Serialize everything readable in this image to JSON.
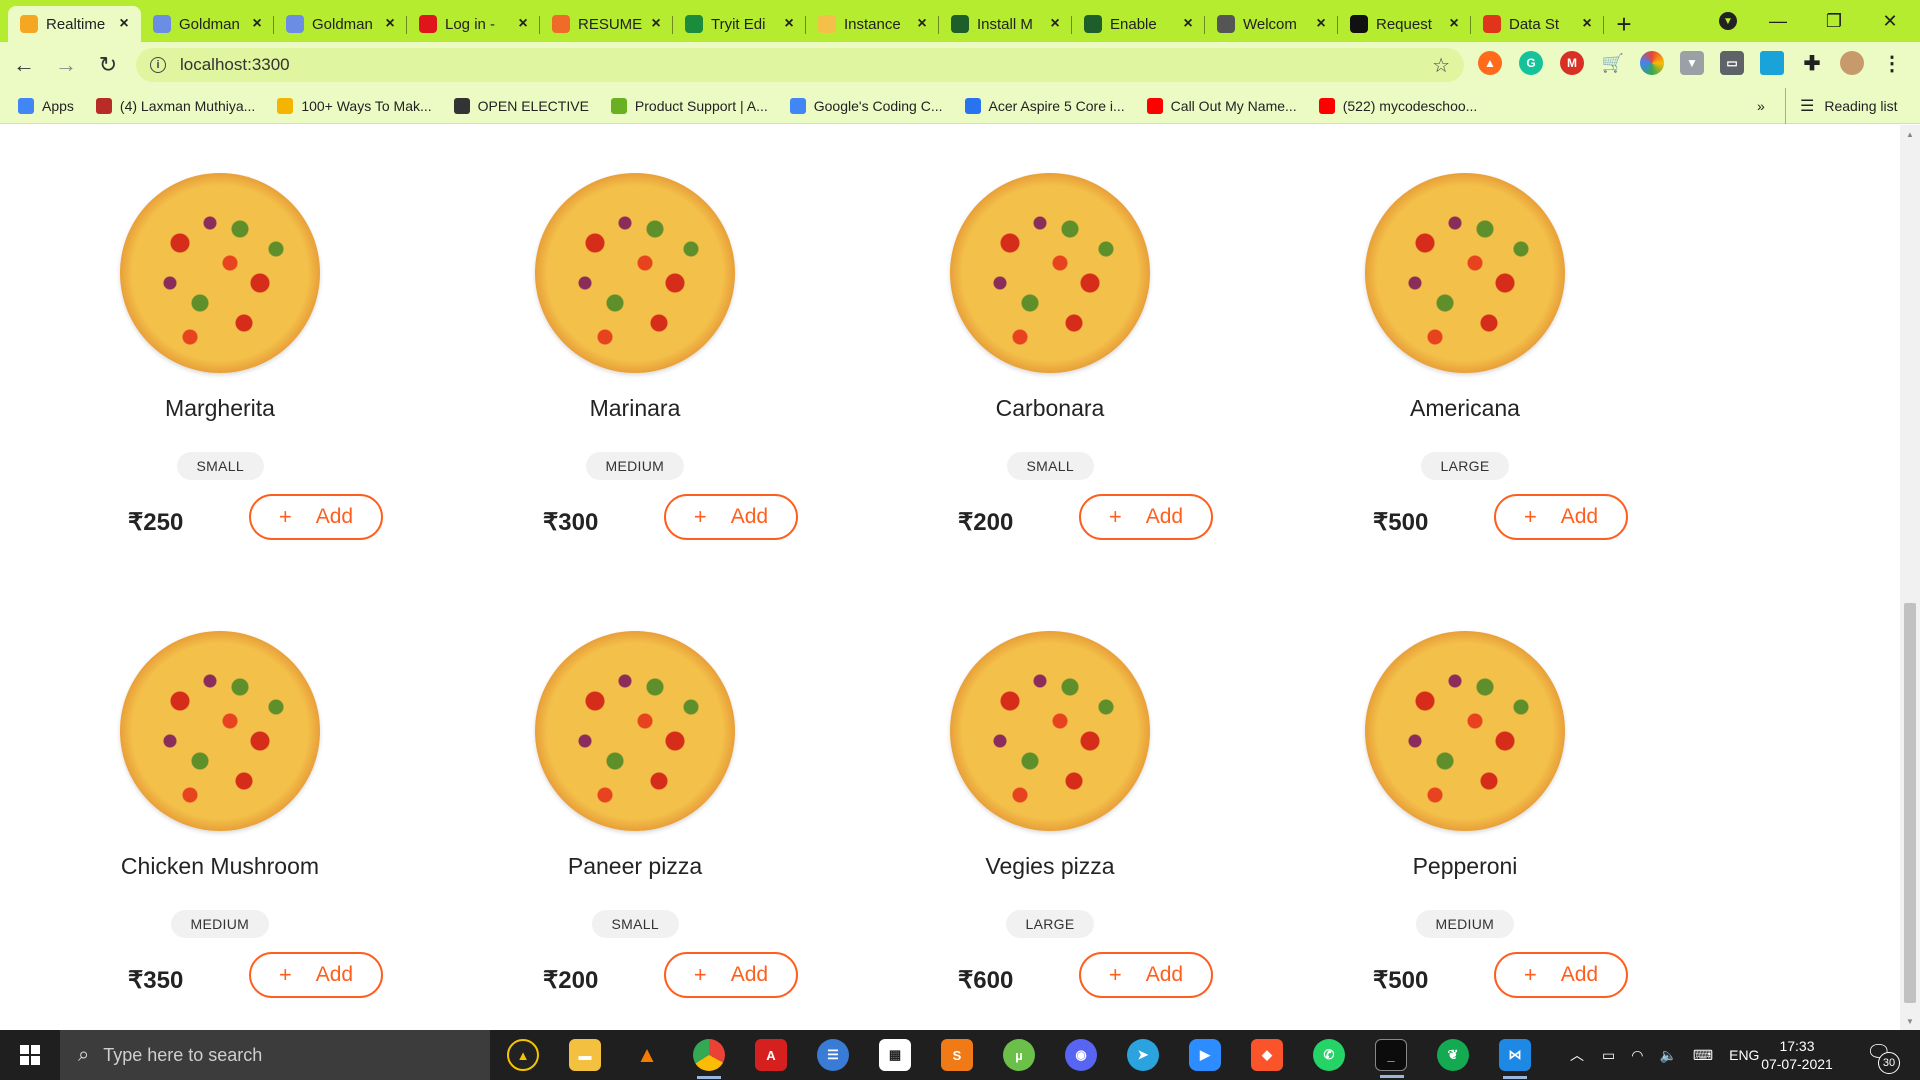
{
  "browser": {
    "tabs": [
      {
        "title": "Realtime",
        "favicon": "pizza-icon",
        "color": "#f5a623",
        "active": true
      },
      {
        "title": "Goldman",
        "favicon": "doc-icon",
        "color": "#6b8de3",
        "active": false
      },
      {
        "title": "Goldman",
        "favicon": "doc-icon",
        "color": "#6b8de3",
        "active": false
      },
      {
        "title": "Log in -",
        "favicon": "opera-icon",
        "color": "#e0151c",
        "active": false
      },
      {
        "title": "RESUME",
        "favicon": "resume-icon",
        "color": "#f06a28",
        "active": false
      },
      {
        "title": "Tryit Edi",
        "favicon": "w3-icon",
        "color": "#1a8c3b",
        "active": false
      },
      {
        "title": "Instance",
        "favicon": "instance-icon",
        "color": "#f5c04a",
        "active": false
      },
      {
        "title": "Install M",
        "favicon": "mongodb-icon",
        "color": "#1e5e2b",
        "active": false
      },
      {
        "title": "Enable",
        "favicon": "mongodb-icon",
        "color": "#1e5e2b",
        "active": false
      },
      {
        "title": "Welcom",
        "favicon": "globe-icon",
        "color": "#555555",
        "active": false
      },
      {
        "title": "Request",
        "favicon": "github-icon",
        "color": "#111111",
        "active": false
      },
      {
        "title": "Data St",
        "favicon": "data-icon",
        "color": "#e0341b",
        "active": false
      }
    ],
    "url": "localhost:3300",
    "bookmarks": [
      {
        "label": "Apps",
        "icon": "apps-grid-icon",
        "color": "#4285f4"
      },
      {
        "label": "(4) Laxman Muthiya...",
        "icon": "quora-icon",
        "color": "#b92b27"
      },
      {
        "label": "100+ Ways To Mak...",
        "icon": "bulb-icon",
        "color": "#f5b400"
      },
      {
        "label": "OPEN ELECTIVE",
        "icon": "globe-icon",
        "color": "#333333"
      },
      {
        "label": "Product Support | A...",
        "icon": "leaf-icon",
        "color": "#6ab023"
      },
      {
        "label": "Google's Coding C...",
        "icon": "google-icon",
        "color": "#4285f4"
      },
      {
        "label": "Acer Aspire 5 Core i...",
        "icon": "flipkart-icon",
        "color": "#2874f0"
      },
      {
        "label": "Call Out My Name...",
        "icon": "youtube-icon",
        "color": "#ff0000"
      },
      {
        "label": "(522) mycodeschoo...",
        "icon": "youtube-icon",
        "color": "#ff0000"
      }
    ],
    "reading_list": "Reading list",
    "more_bookmarks": "»"
  },
  "menu": {
    "currency": "₹",
    "add_label": "Add",
    "add_plus": "+",
    "accent_color": "#fe5f1e",
    "pizzas": [
      {
        "name": "Margherita",
        "size": "SMALL",
        "price": "₹250"
      },
      {
        "name": "Marinara",
        "size": "MEDIUM",
        "price": "₹300"
      },
      {
        "name": "Carbonara",
        "size": "SMALL",
        "price": "₹200"
      },
      {
        "name": "Americana",
        "size": "LARGE",
        "price": "₹500"
      },
      {
        "name": "Chicken Mushroom",
        "size": "MEDIUM",
        "price": "₹350"
      },
      {
        "name": "Paneer pizza",
        "size": "SMALL",
        "price": "₹200"
      },
      {
        "name": "Vegies pizza",
        "size": "LARGE",
        "price": "₹600"
      },
      {
        "name": "Pepperoni",
        "size": "MEDIUM",
        "price": "₹500"
      }
    ]
  },
  "taskbar": {
    "search_placeholder": "Type here to search",
    "language": "ENG",
    "time": "17:33",
    "date": "07-07-2021",
    "notification_count": "30"
  }
}
